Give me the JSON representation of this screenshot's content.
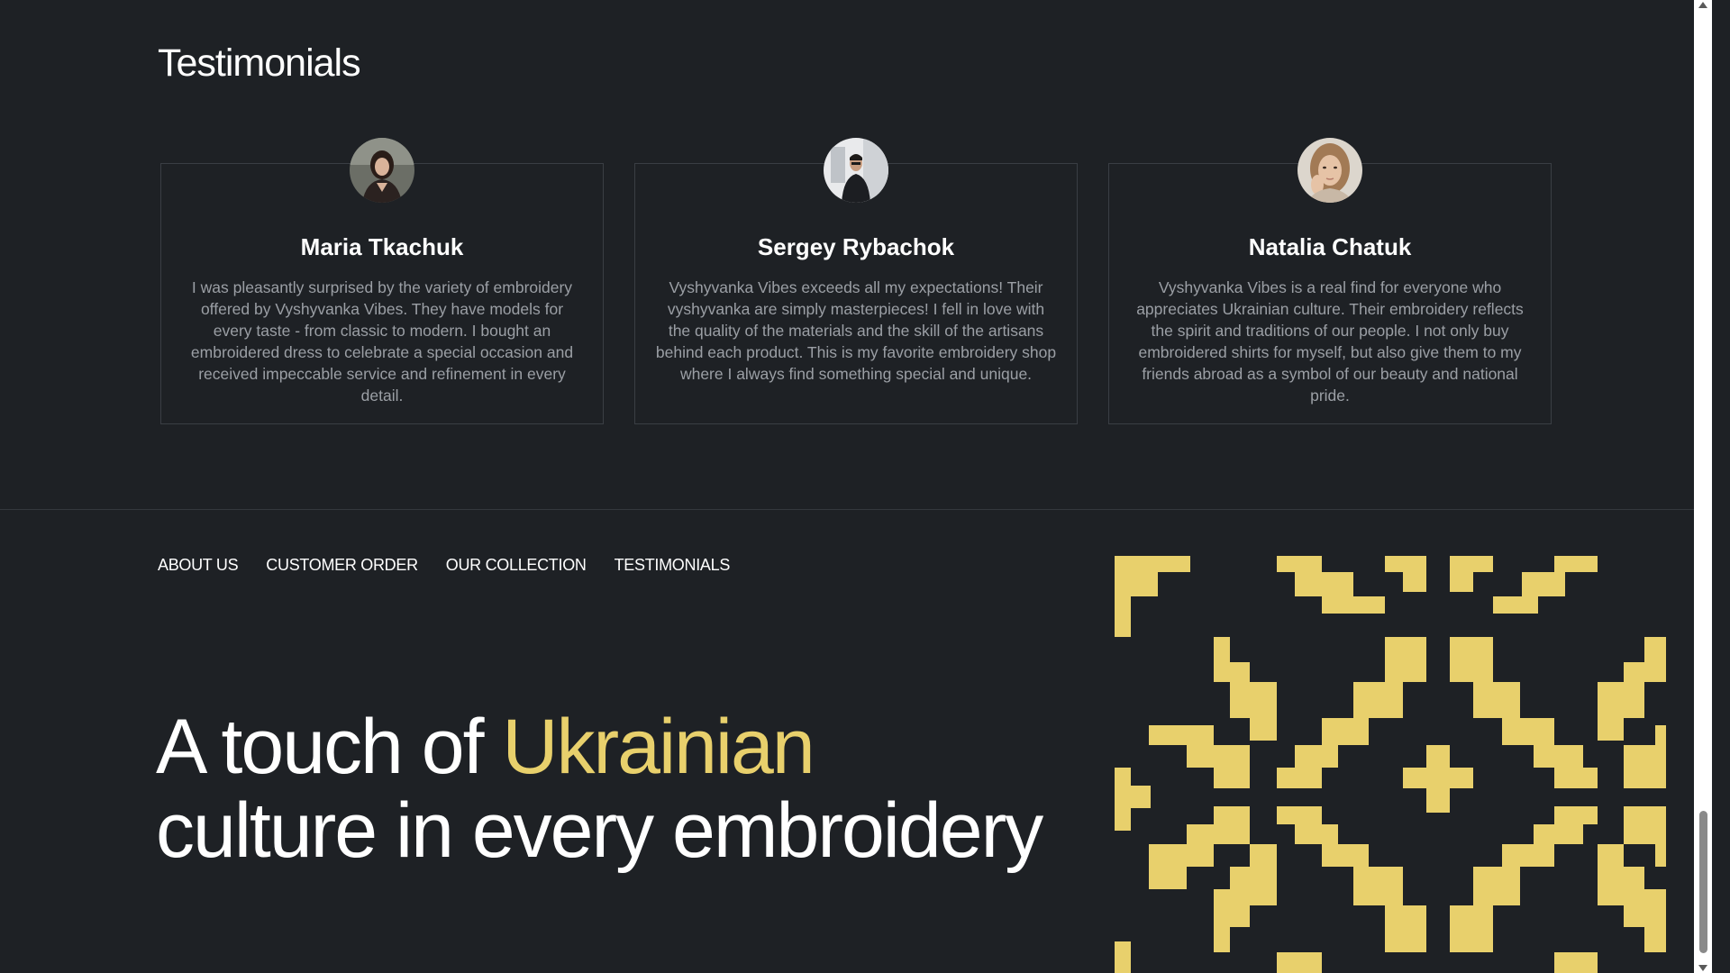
{
  "testimonials": {
    "title": "Testimonials",
    "items": [
      {
        "name": "Maria Tkachuk",
        "quote": "I was pleasantly surprised by the variety of embroidery offered by Vyshyvanka Vibes. They have models for every taste - from classic to modern. I bought an embroidered dress to celebrate a special occasion and received impeccable service and refinement in every detail."
      },
      {
        "name": "Sergey Rybachok",
        "quote": "Vyshyvanka Vibes exceeds all my expectations! Their vyshyvanka are simply masterpieces! I fell in love with the quality of the materials and the skill of the artisans behind each product. This is my favorite embroidery shop where I always find something special and unique."
      },
      {
        "name": "Natalia Chatuk",
        "quote": "Vyshyvanka Vibes is a real find for everyone who appreciates Ukrainian culture. Their embroidery reflects the spirit and traditions of our people. I not only buy embroidered shirts for myself, but also give them to my friends abroad as a symbol of our beauty and national pride."
      }
    ]
  },
  "footer": {
    "nav": [
      "ABOUT US",
      "CUSTOMER ORDER",
      "OUR COLLECTION",
      "TESTIMONIALS"
    ],
    "hero_before": "A touch of ",
    "hero_accent": "Ukrainian",
    "hero_after": "culture in every embroidery"
  },
  "colors": {
    "background": "#1e2125",
    "accent": "#e8d06c",
    "ornament": "#e8d06c",
    "muted_text": "#9b9fa5"
  },
  "icons": {
    "avatars": [
      "avatar-photo",
      "avatar-photo",
      "avatar-photo"
    ],
    "ornament": "embroidery-pattern"
  }
}
